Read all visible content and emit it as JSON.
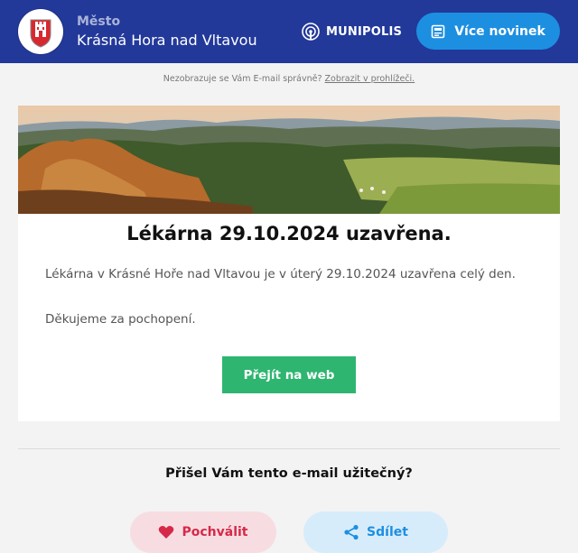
{
  "header": {
    "town_label": "Město",
    "town_name": "Krásná Hora nad Vltavou",
    "brand": "MUNIPOLIS",
    "more_news_label": "Více novinek",
    "icons": {
      "crest": "town-crest-icon",
      "brand": "munipolis-logo-icon",
      "news": "newspaper-icon"
    }
  },
  "note": {
    "text": "Nezobrazuje se Vám E-mail správně?",
    "link": "Zobrazit v prohlížeči."
  },
  "article": {
    "title": "Lékárna 29.10.2024 uzavřena.",
    "paragraph1": "Lékárna v Krásné Hoře nad Vltavou  je v úterý 29.10.2024 uzavřena celý den.",
    "paragraph2": "Děkujeme za pochopení.",
    "button_label": "Přejít na web"
  },
  "feedback": {
    "question": "Přišel Vám tento e-mail užitečný?",
    "praise_label": "Pochválit",
    "share_label": "Sdílet",
    "icons": {
      "praise": "heart-icon",
      "share": "share-icon"
    }
  },
  "colors": {
    "header_bg": "#22399a",
    "accent_blue": "#1d8fe1",
    "button_green": "#2eb570",
    "praise_red": "#d6294a"
  }
}
